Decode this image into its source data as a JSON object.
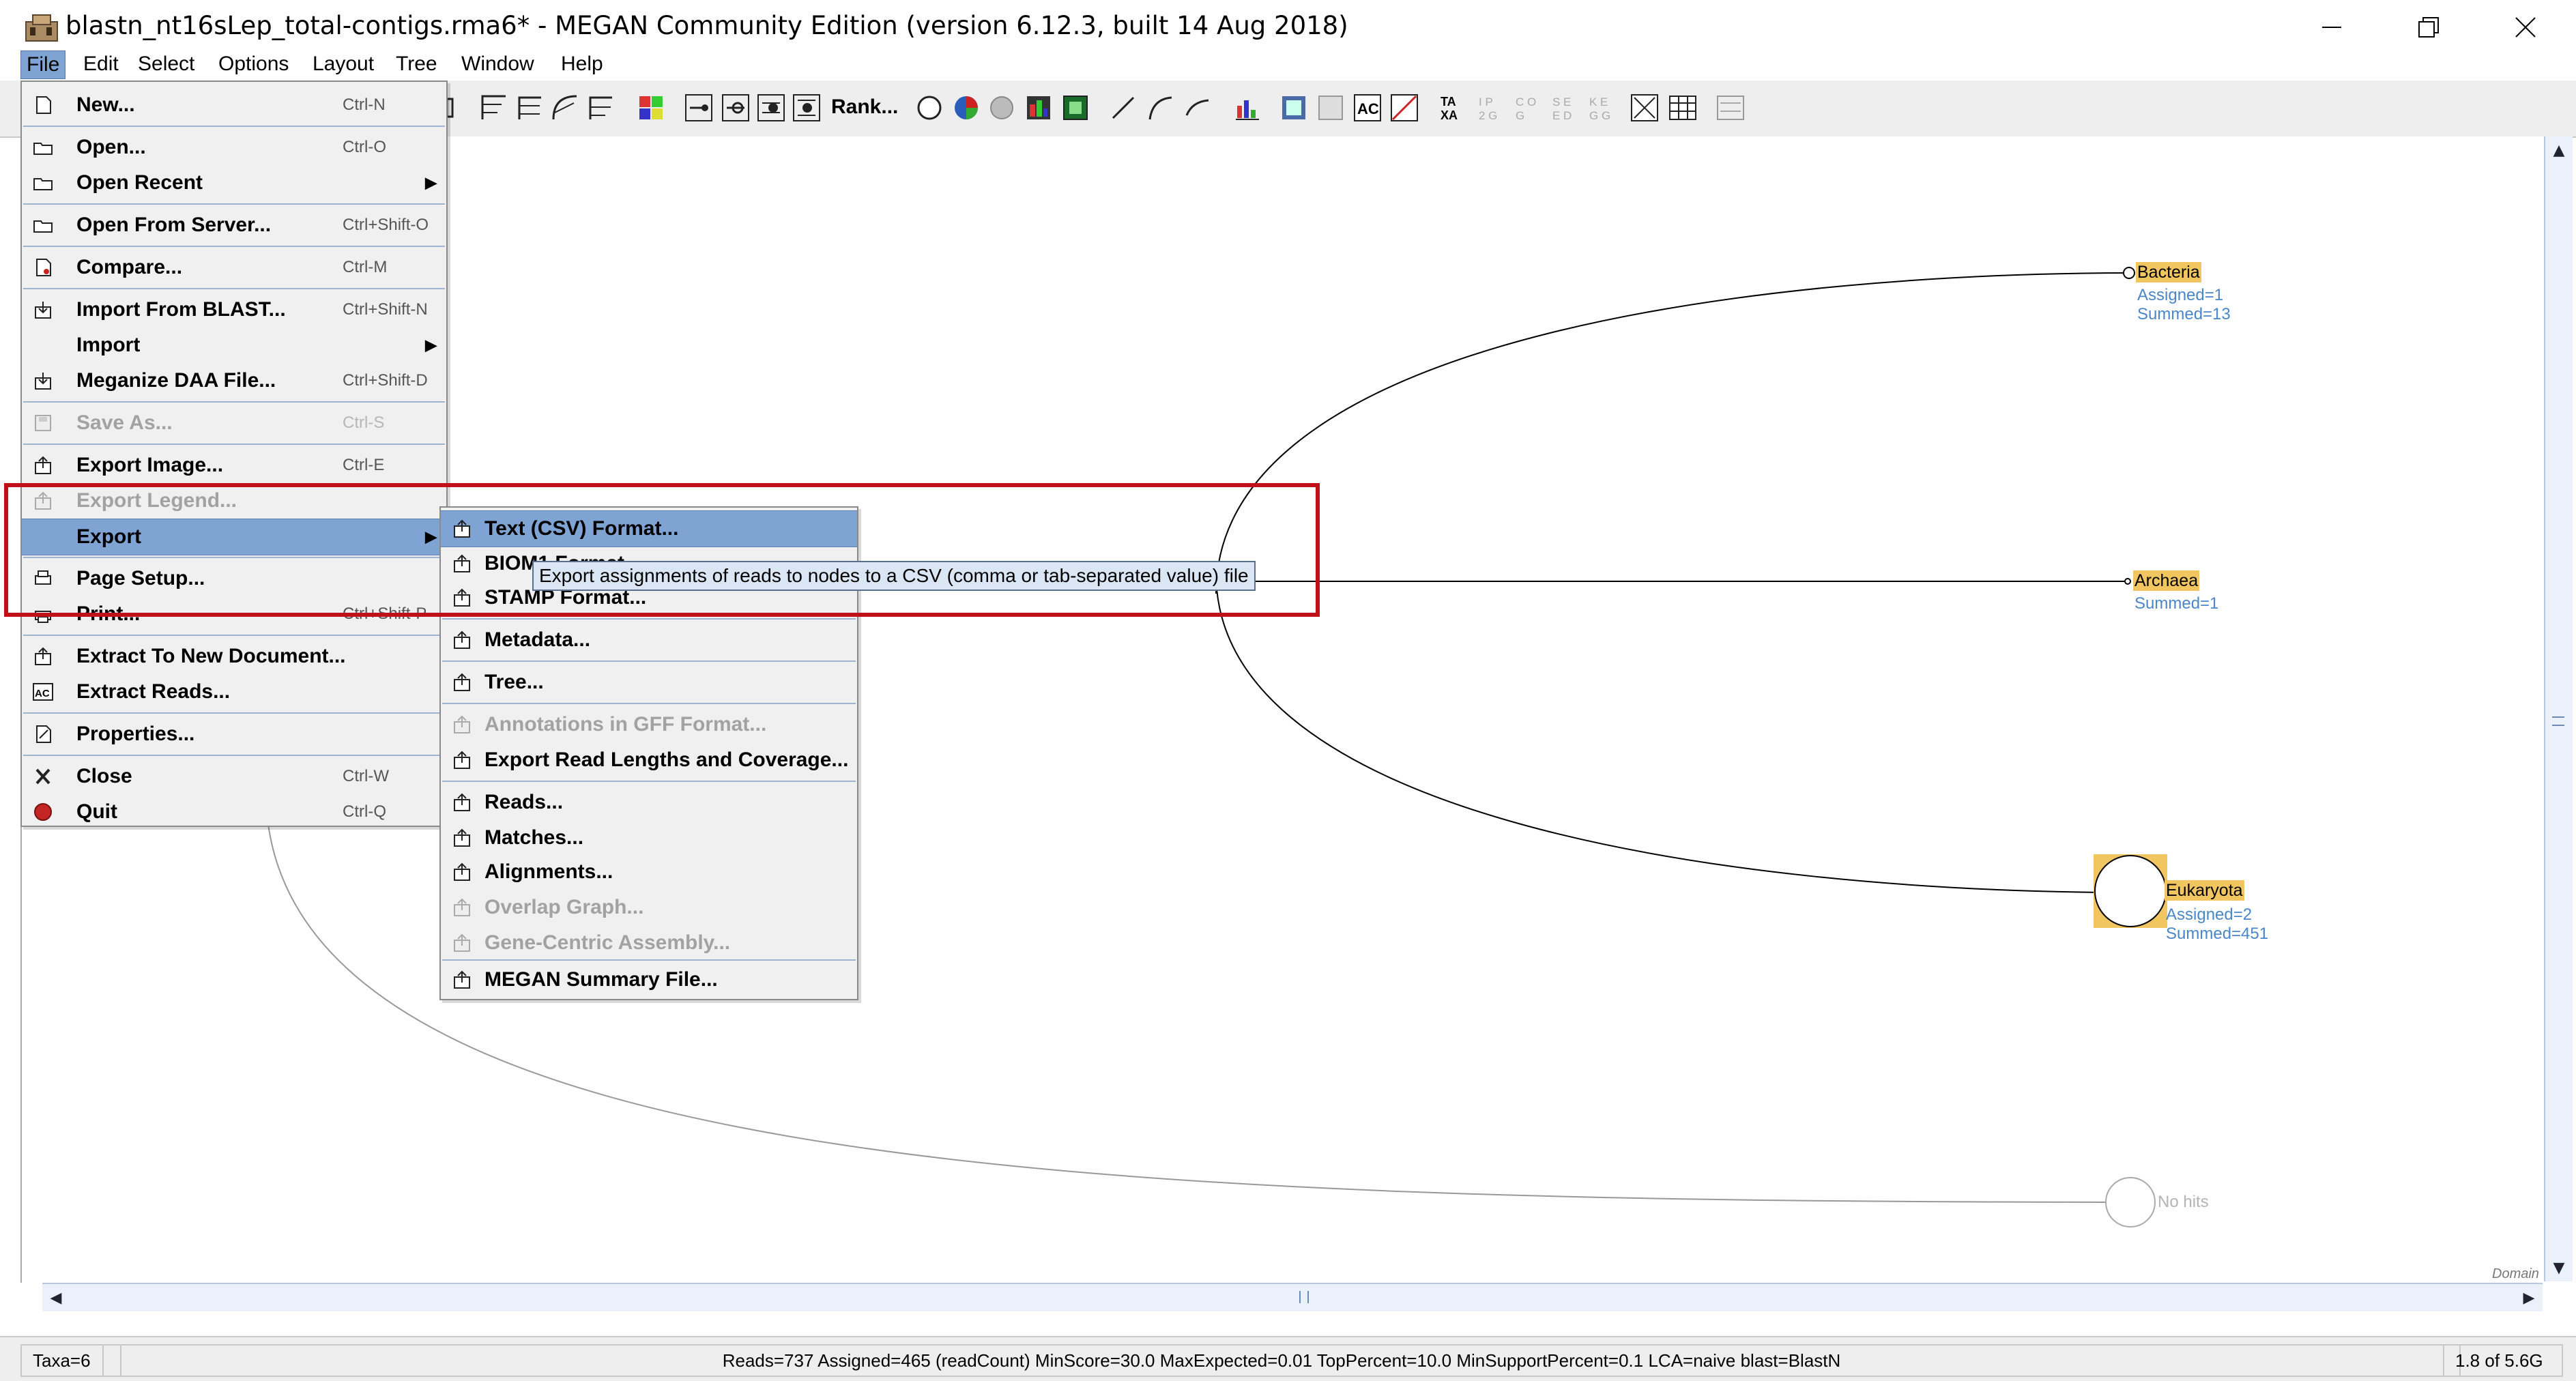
{
  "window": {
    "title": "blastn_nt16sLep_total-contigs.rma6* - MEGAN Community Edition (version 6.12.3, built 14 Aug 2018)",
    "app_icon": "megan-icon",
    "controls": [
      "minimize-icon",
      "restore-icon",
      "close-icon"
    ]
  },
  "menubar": {
    "items": [
      "File",
      "Edit",
      "Select",
      "Options",
      "Layout",
      "Tree",
      "Window",
      "Help"
    ],
    "active": "File"
  },
  "toolbar": {
    "rank_label": "Rank..."
  },
  "file_menu": {
    "items": [
      {
        "label": "New...",
        "shortcut": "Ctrl-N",
        "icon": "new-document-icon"
      },
      {
        "label": "Open...",
        "shortcut": "Ctrl-O",
        "icon": "open-folder-icon"
      },
      {
        "label": "Open Recent",
        "shortcut": "",
        "icon": "open-folder-icon",
        "submenu": true
      },
      {
        "label": "Open From Server...",
        "shortcut": "Ctrl+Shift-O",
        "icon": "open-folder-icon"
      },
      {
        "label": "Compare...",
        "shortcut": "Ctrl-M",
        "icon": "compare-icon"
      },
      {
        "label": "Import From BLAST...",
        "shortcut": "Ctrl+Shift-N",
        "icon": "import-icon"
      },
      {
        "label": "Import",
        "shortcut": "",
        "icon": "",
        "submenu": true
      },
      {
        "label": "Meganize DAA File...",
        "shortcut": "Ctrl+Shift-D",
        "icon": "import-icon"
      },
      {
        "label": "Save As...",
        "shortcut": "Ctrl-S",
        "icon": "save-icon",
        "disabled": true
      },
      {
        "label": "Export Image...",
        "shortcut": "Ctrl-E",
        "icon": "export-icon"
      },
      {
        "label": "Export Legend...",
        "shortcut": "",
        "icon": "export-icon",
        "disabled": true
      },
      {
        "label": "Export",
        "shortcut": "",
        "icon": "",
        "submenu": true,
        "highlighted": true
      },
      {
        "label": "Page Setup...",
        "shortcut": "",
        "icon": "page-setup-icon"
      },
      {
        "label": "Print...",
        "shortcut": "Ctrl+Shift-P",
        "icon": "print-icon"
      },
      {
        "label": "Extract To New Document...",
        "shortcut": "",
        "icon": "export-icon"
      },
      {
        "label": "Extract Reads...",
        "shortcut": "",
        "icon": "ac-icon"
      },
      {
        "label": "Properties...",
        "shortcut": "",
        "icon": "properties-icon"
      },
      {
        "label": "Close",
        "shortcut": "Ctrl-W",
        "icon": "close-x-icon"
      },
      {
        "label": "Quit",
        "shortcut": "Ctrl-Q",
        "icon": "quit-icon"
      }
    ]
  },
  "export_submenu": {
    "items": [
      {
        "label": "Text (CSV) Format...",
        "highlighted": true
      },
      {
        "label": "BIOM1 Format..."
      },
      {
        "label": "STAMP Format..."
      },
      {
        "label": "Metadata..."
      },
      {
        "label": "Tree..."
      },
      {
        "label": "Annotations in GFF Format...",
        "disabled": true
      },
      {
        "label": "Export Read Lengths and Coverage..."
      },
      {
        "label": "Reads..."
      },
      {
        "label": "Matches..."
      },
      {
        "label": "Alignments..."
      },
      {
        "label": "Overlap Graph...",
        "disabled": true
      },
      {
        "label": "Gene-Centric Assembly...",
        "disabled": true
      },
      {
        "label": "MEGAN Summary File..."
      }
    ]
  },
  "tooltip": "Export assignments of reads to nodes to a CSV (comma or tab-separated value) file",
  "tree": {
    "bacteria": {
      "name": "Bacteria",
      "assigned": "Assigned=1",
      "summed": "Summed=13"
    },
    "archaea": {
      "name": "Archaea",
      "summed": "Summed=1"
    },
    "eukaryota": {
      "name": "Eukaryota",
      "assigned": "Assigned=2",
      "summed": "Summed=451"
    },
    "nohits": {
      "name": "No hits"
    },
    "rank_label": "Domain"
  },
  "statusbar": {
    "taxa": "Taxa=6",
    "info": "Reads=737 Assigned=465 (readCount) MinScore=30.0 MaxExpected=0.01 TopPercent=10.0 MinSupportPercent=0.1 LCA=naive blast=BlastN",
    "memory": "1.8 of 5.6G"
  },
  "colors": {
    "highlight_box": "#c0111a",
    "menu_highlight": "#7fa4d4",
    "node_label_bg": "#f1c660",
    "count_text": "#4a86c8"
  }
}
